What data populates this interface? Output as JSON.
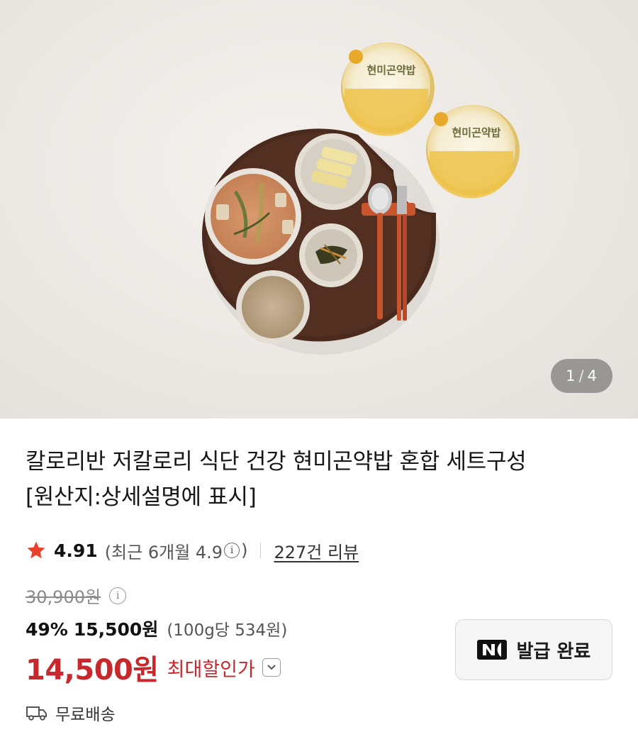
{
  "gallery": {
    "current": "1",
    "total": "4",
    "separator": "/",
    "colors": {
      "background": "#ebe7e3",
      "tray": "#4a2a1d",
      "package_lid": "#f0c64a"
    },
    "package_label": "현미곤약밥"
  },
  "product": {
    "title_line1": "칼로리반 저칼로리 식단 건강 현미곤약밥 혼합 세트구성",
    "title_line2": "[원산지:상세설명에 표시]"
  },
  "rating": {
    "icon": "star-icon",
    "score": "4.91",
    "recent_prefix": "(최근 6개월 4.9",
    "recent_suffix": ")",
    "reviews_link": "227건 리뷰",
    "star_color": "#e8412c"
  },
  "price": {
    "original": "30,900원",
    "discount_pct": "49%",
    "sale_price": "15,500원",
    "unit_price": "(100g당 534원)",
    "max_discount_price": "14,500원",
    "max_discount_label": "최대할인가",
    "accent_color": "#c8282c"
  },
  "coupon": {
    "icon": "naver-n-icon",
    "label": "발급 완료"
  },
  "shipping": {
    "icon": "truck-icon",
    "label": "무료배송"
  }
}
